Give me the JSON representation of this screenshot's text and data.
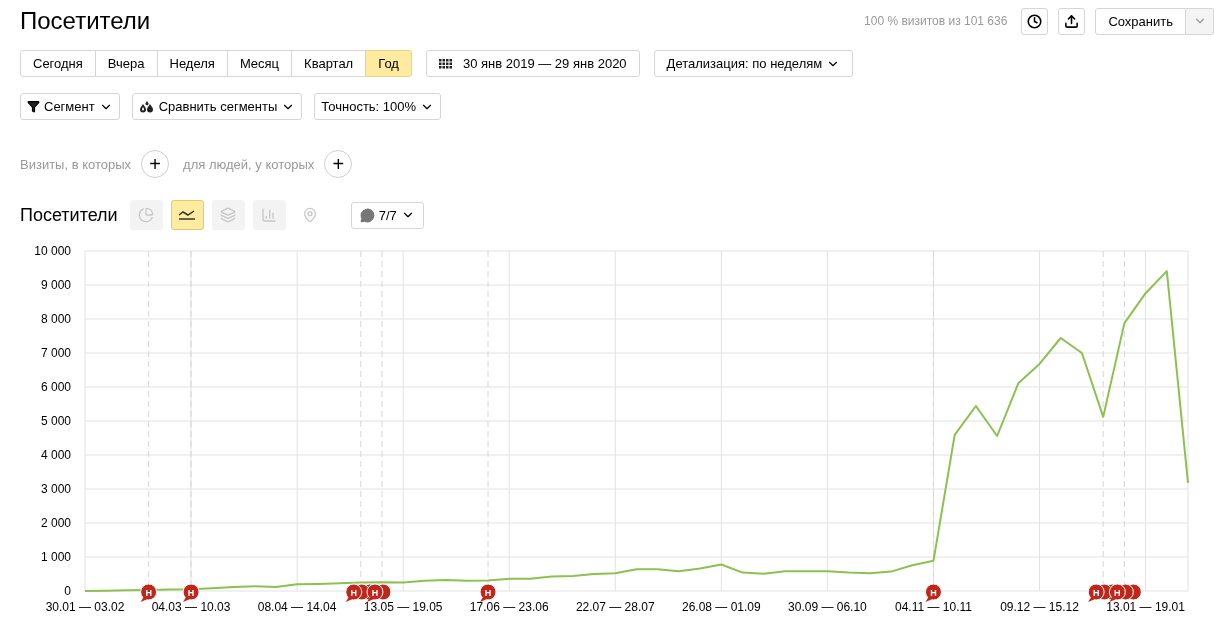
{
  "title": "Посетители",
  "sampling_note": "100 % визитов из 101 636",
  "save_button": "Сохранить",
  "periods": [
    {
      "label": "Сегодня",
      "selected": false
    },
    {
      "label": "Вчера",
      "selected": false
    },
    {
      "label": "Неделя",
      "selected": false
    },
    {
      "label": "Месяц",
      "selected": false
    },
    {
      "label": "Квартал",
      "selected": false
    },
    {
      "label": "Год",
      "selected": true
    }
  ],
  "date_range": "30 янв 2019 — 29 янв 2020",
  "detail_dropdown": "Детализация: по неделям",
  "filters": [
    {
      "kind": "segment",
      "label": "Сегмент"
    },
    {
      "kind": "compare",
      "label": "Сравнить сегменты"
    },
    {
      "kind": "accuracy",
      "label": "Точность: 100%"
    }
  ],
  "conditions": [
    {
      "label": "Визиты, в которых",
      "button": "+"
    },
    {
      "label": "для людей, у которых",
      "button": "+"
    }
  ],
  "chart_title": "Посетители",
  "chart_types": [
    {
      "kind": "pie",
      "selected": false
    },
    {
      "kind": "line",
      "selected": true
    },
    {
      "kind": "area",
      "selected": false
    },
    {
      "kind": "bar",
      "selected": false
    },
    {
      "kind": "map",
      "selected": false
    }
  ],
  "notes_dropdown": "7/7",
  "chart_data": {
    "type": "line",
    "categories": [
      "30.01 — 03.02",
      null,
      null,
      null,
      null,
      "04.03 — 10.03",
      null,
      null,
      null,
      null,
      "08.04 — 14.04",
      null,
      null,
      null,
      null,
      "13.05 — 19.05",
      null,
      null,
      null,
      null,
      "17.06 — 23.06",
      null,
      null,
      null,
      null,
      "22.07 — 28.07",
      null,
      null,
      null,
      null,
      "26.08 — 01.09",
      null,
      null,
      null,
      null,
      "30.09 — 06.10",
      null,
      null,
      null,
      null,
      "04.11 — 10.11",
      null,
      null,
      null,
      null,
      "09.12 — 15.12",
      null,
      null,
      null,
      null,
      "13.01 — 19.01",
      null,
      null
    ],
    "series": [
      {
        "color": "#8cc152",
        "values": [
          0,
          10,
          20,
          30,
          40,
          50,
          80,
          120,
          140,
          120,
          200,
          210,
          230,
          250,
          260,
          250,
          300,
          320,
          300,
          310,
          360,
          360,
          430,
          440,
          500,
          520,
          640,
          640,
          580,
          660,
          780,
          540,
          510,
          580,
          580,
          580,
          540,
          520,
          570,
          760,
          890,
          4590,
          5440,
          4560,
          6110,
          6680,
          7440,
          7000,
          5120,
          7880,
          8760,
          9410,
          3180
        ]
      }
    ],
    "yticks": [
      {
        "value": 0,
        "label": "0"
      },
      {
        "value": 1000,
        "label": "1 000"
      },
      {
        "value": 2000,
        "label": "2 000"
      },
      {
        "value": 3000,
        "label": "3 000"
      },
      {
        "value": 4000,
        "label": "4 000"
      },
      {
        "value": 5000,
        "label": "5 000"
      },
      {
        "value": 6000,
        "label": "6 000"
      },
      {
        "value": 7000,
        "label": "7 000"
      },
      {
        "value": 8000,
        "label": "8 000"
      },
      {
        "value": 9000,
        "label": "9 000"
      },
      {
        "value": 10000,
        "label": "10 000"
      }
    ],
    "ylim": [
      0,
      10000
    ],
    "grid": true
  },
  "chart_notes": [
    {
      "label": "Н"
    },
    {
      "label": "Н"
    },
    {
      "label": "Н"
    },
    {
      "label": "Н"
    },
    {
      "label": "Н"
    },
    {
      "label": "Н"
    },
    {
      "label": "Н"
    },
    {
      "label": "Н"
    }
  ]
}
